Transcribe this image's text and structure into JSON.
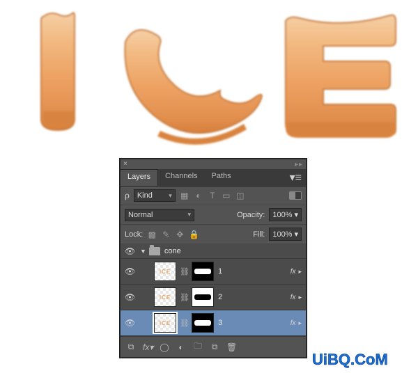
{
  "panel": {
    "tabs": [
      "Layers",
      "Channels",
      "Paths"
    ],
    "active_tab": 0,
    "filter_label": "Kind",
    "blend_mode": "Normal",
    "opacity_label": "Opacity:",
    "opacity_value": "100%",
    "lock_label": "Lock:",
    "fill_label": "Fill:",
    "fill_value": "100%",
    "group_name": "cone",
    "layers": [
      {
        "name": "1",
        "thumb_text": "ICE"
      },
      {
        "name": "2",
        "thumb_text": "ICE"
      },
      {
        "name": "3",
        "thumb_text": "ICE"
      }
    ],
    "selected_layer": 2
  },
  "watermark": "UiBQ.CoM",
  "artwork_text": "ICE"
}
